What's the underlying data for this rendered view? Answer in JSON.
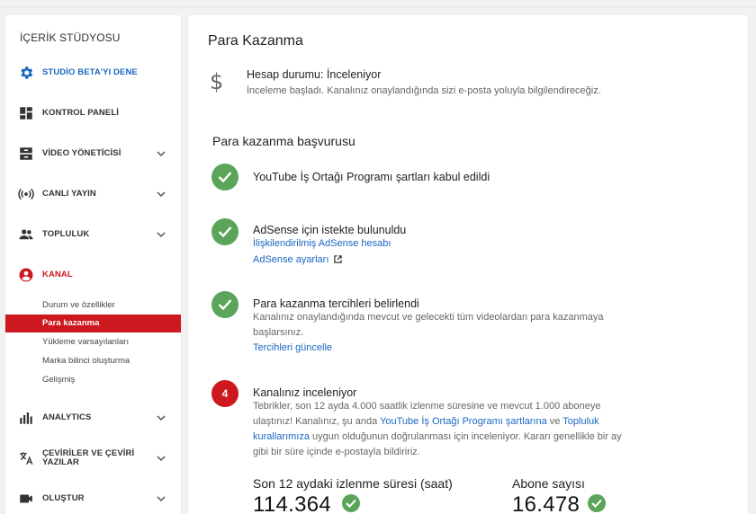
{
  "sidebar": {
    "title": "İÇERİK STÜDYOSU",
    "items": [
      {
        "label": "STUDİO BETA'YI DENE",
        "icon": "gear-icon"
      },
      {
        "label": "KONTROL PANELİ",
        "icon": "dashboard-icon"
      },
      {
        "label": "VİDEO YÖNETİCİSİ",
        "icon": "video-manager-icon"
      },
      {
        "label": "CANLI YAYIN",
        "icon": "live-broadcast-icon"
      },
      {
        "label": "TOPLULUK",
        "icon": "community-icon"
      },
      {
        "label": "KANAL",
        "icon": "channel-icon"
      },
      {
        "label": "ANALYTICS",
        "icon": "analytics-icon"
      },
      {
        "label": "ÇEVİRİLER VE ÇEVİRİ YAZILAR",
        "icon": "translate-icon"
      },
      {
        "label": "OLUŞTUR",
        "icon": "create-video-icon"
      }
    ],
    "channel_sub": [
      {
        "label": "Durum ve özellikler"
      },
      {
        "label": "Para kazanma"
      },
      {
        "label": "Yükleme varsayılanları"
      },
      {
        "label": "Marka bilinci oluşturma"
      },
      {
        "label": "Gelişmiş"
      }
    ]
  },
  "main": {
    "title": "Para Kazanma",
    "status_icon": "$",
    "status_title": "Hesap durumu: İnceleniyor",
    "status_desc": "İnceleme başladı. Kanalınız onaylandığında sizi e-posta yoluyla bilgilendireceğiz.",
    "section_title": "Para kazanma başvurusu",
    "steps": [
      {
        "title": "YouTube İş Ortağı Programı şartları kabul edildi"
      },
      {
        "title": "AdSense için istekte bulunuldu",
        "link1": "İlişkilendirilmiş AdSense hesabı",
        "link2": "AdSense ayarları"
      },
      {
        "title": "Para kazanma tercihleri belirlendi",
        "text": "Kanalınız onaylandığında mevcut ve gelecekti tüm videolardan para kazanmaya başlarsınız.",
        "link": "Tercihleri güncelle"
      },
      {
        "number": "4",
        "title": "Kanalınız inceleniyor",
        "text_part1": "Tebrikler, son 12 ayda 4.000 saatlik izlenme süresine ve mevcut 1.000 aboneye ulaştınız! Kanalınız, şu anda ",
        "link_a": "YouTube İş Ortağı Programı şartlarına",
        "text_part2": " ve ",
        "link_b": "Topluluk kurallarımıza",
        "text_part3": " uygun olduğunun doğrulanması için inceleniyor. Kararı genellikle bir ay gibi bir süre içinde e-postayla bildiririz."
      }
    ],
    "stats": [
      {
        "label": "Son 12 aydaki izlenme süresi (saat)",
        "value": "114.364"
      },
      {
        "label": "Abone sayısı",
        "value": "16.478"
      }
    ]
  },
  "colors": {
    "accent_red": "#cc181e",
    "link_blue": "#1a67c2",
    "check_green": "#5ba55b"
  }
}
